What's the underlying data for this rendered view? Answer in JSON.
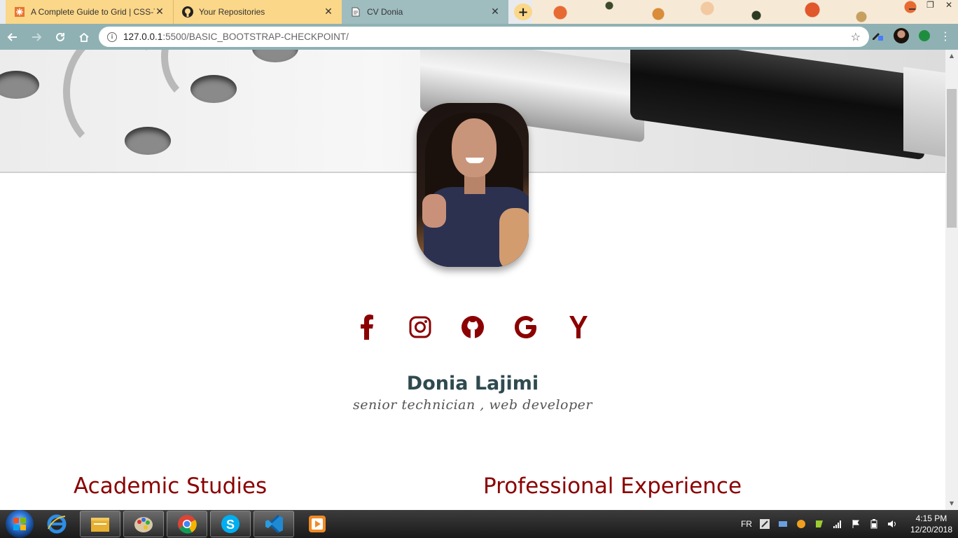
{
  "browser": {
    "tabs": [
      {
        "title": "A Complete Guide to Grid | CSS-T",
        "favicon": "css-tricks-icon"
      },
      {
        "title": "Your Repositories",
        "favicon": "github-icon"
      },
      {
        "title": "CV Donia",
        "favicon": "document-icon",
        "active": true
      }
    ],
    "new_tab_label": "+",
    "url_host": "127.0.0.1",
    "url_path": ":5500/BASIC_BOOTSTRAP-CHECKPOINT/"
  },
  "profile": {
    "name": "Donia Lajimi",
    "role": "senior technician , web developer"
  },
  "social": [
    {
      "icon": "facebook-icon"
    },
    {
      "icon": "instagram-icon"
    },
    {
      "icon": "github-icon"
    },
    {
      "icon": "google-icon"
    },
    {
      "icon": "yahoo-icon"
    }
  ],
  "sections": {
    "left_title": "Academic Studies",
    "right_title": "Professional Experience"
  },
  "taskbar": {
    "language": "FR",
    "time": "4:15 PM",
    "date": "12/20/2018"
  },
  "colors": {
    "accent": "#8b0000",
    "name": "#2f4a4f",
    "toolbar": "#8fb1b3"
  }
}
